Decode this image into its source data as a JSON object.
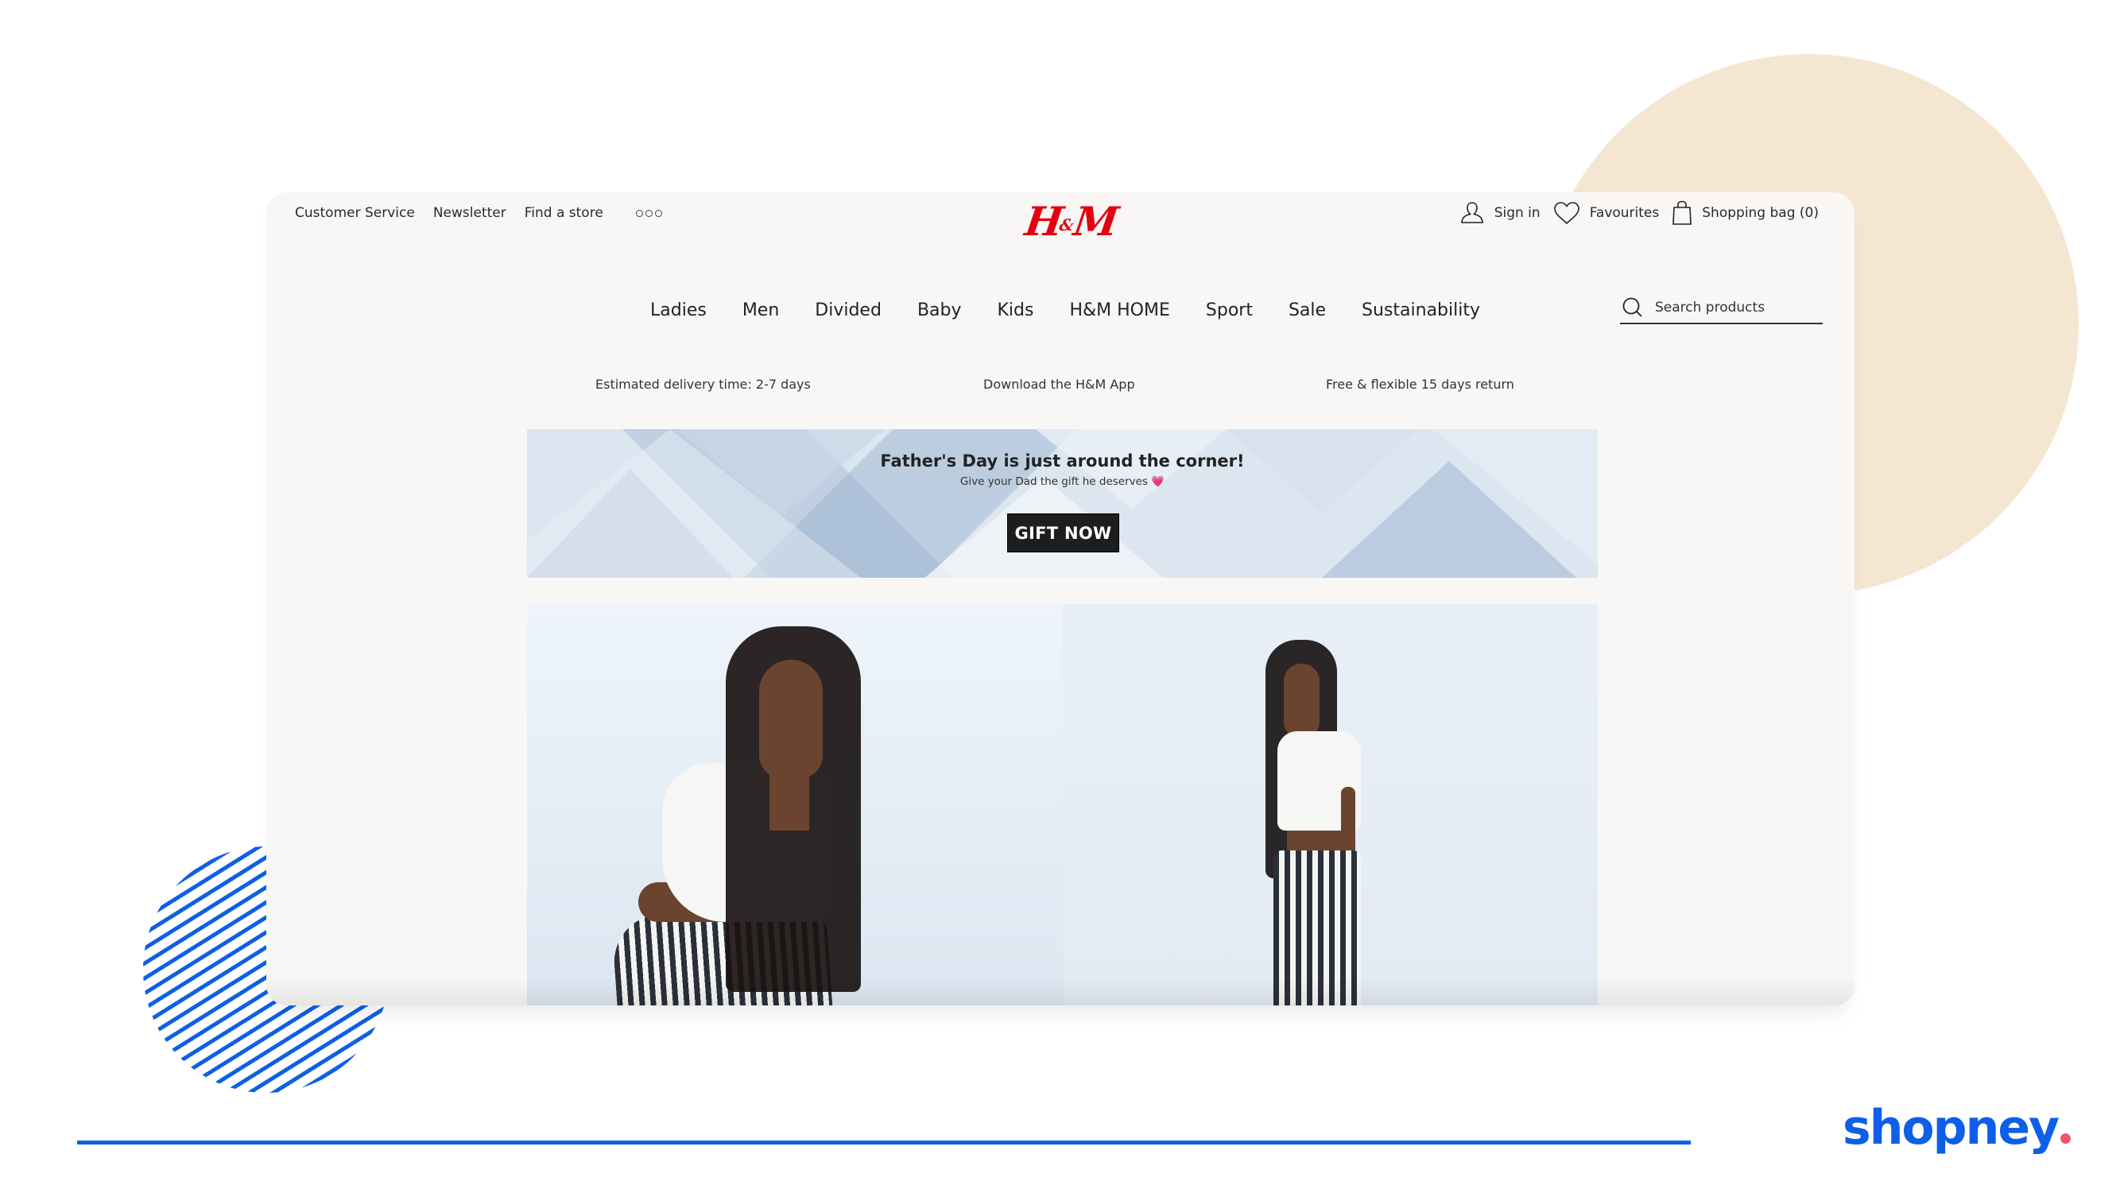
{
  "site": {
    "logo_text": "H&M",
    "brand_color": "#E50010"
  },
  "utility_bar": {
    "links": [
      "Customer Service",
      "Newsletter",
      "Find a store"
    ],
    "more_icon": "more-dots-icon"
  },
  "account": {
    "sign_in": "Sign in",
    "favourites": "Favourites",
    "shopping_bag": "Shopping bag (0)"
  },
  "main_nav": {
    "items": [
      "Ladies",
      "Men",
      "Divided",
      "Baby",
      "Kids",
      "H&M HOME",
      "Sport",
      "Sale",
      "Sustainability"
    ]
  },
  "search": {
    "placeholder": "Search products",
    "value": ""
  },
  "usp": {
    "items": [
      "Estimated delivery time: 2-7 days",
      "Download the H&M App",
      "Free & flexible 15 days return"
    ]
  },
  "banner": {
    "title": "Father's Day is just around the corner!",
    "subtitle": "Give your Dad the gift he deserves",
    "emoji": "💗",
    "button": "GIFT NOW"
  },
  "hero_images": [
    {
      "description": "Model with long braids in white crop top and striped trousers, crouching"
    },
    {
      "description": "Model with long braids in white crop top and striped trousers, standing"
    }
  ],
  "footer_brand": {
    "name": "shopney",
    "color": "#0E5FE8",
    "dot_color": "#F2526E"
  },
  "decor": {
    "circle_color": "#F5E6D1",
    "stripe_color": "#0E5FE8"
  }
}
